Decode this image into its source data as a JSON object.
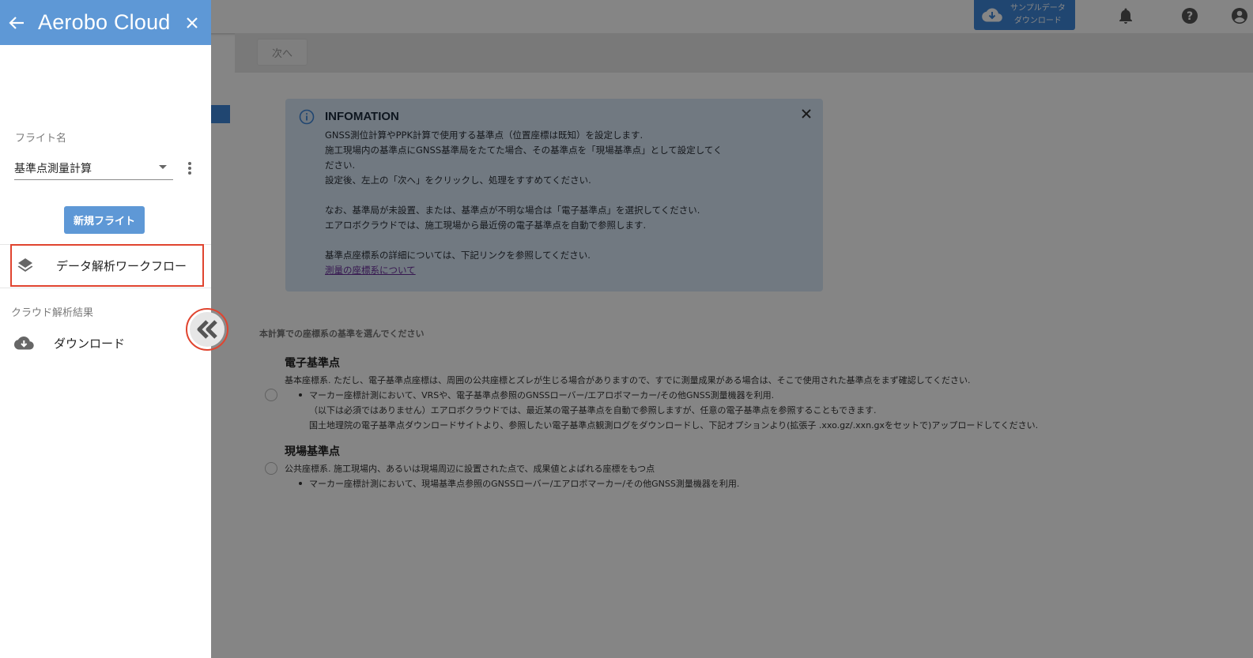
{
  "topbar": {
    "sample_download_line1": "サンプルデータ",
    "sample_download_line2": "ダウンロード",
    "icons": [
      "cloud-download-icon",
      "bell-icon",
      "help-icon",
      "account-icon"
    ]
  },
  "toolbar": {
    "next_label": "次へ"
  },
  "info": {
    "title": "INFOMATION",
    "lines_a": [
      "GNSS測位計算やPPK計算で使用する基準点（位置座標は既知）を設定します.",
      "施工現場内の基準点にGNSS基準局をたてた場合、その基準点を「現場基準点」として設定してく",
      "ださい.",
      "設定後、左上の「次へ」をクリックし、処理をすすめてください."
    ],
    "lines_b": [
      "なお、基準局が未設置、または、基準点が不明な場合は「電子基準点」を選択してください.",
      "エアロボクラウドでは、施工現場から最近傍の電子基準点を自動で参照します."
    ],
    "lines_c": [
      "基準点座標系の詳細については、下記リンクを参照してください."
    ],
    "link": "測量の座標系について"
  },
  "coord_select": {
    "label": "本計算での座標系の基準を選んでください",
    "option1": {
      "title": "電子基準点",
      "desc": "基本座標系. ただし、電子基準点座標は、周囲の公共座標とズレが生じる場合がありますので、すでに測量成果がある場合は、そこで使用された基準点をまず確認してください.",
      "bullet": "マーカー座標計測において、VRSや、電子基準点参照のGNSSローバー/エアロボマーカー/その他GNSS測量機器を利用.",
      "sub1": "（以下は必須ではありません）エアロボクラウドでは、最近某の電子基準点を自動で参照しますが、任意の電子基準点を参照することもできます.",
      "sub2": "国土地理院の電子基準点ダウンロードサイトより、参照したい電子基準点観測ログをダウンロードし、下記オプションより(拡張子 .xxo.gz/.xxn.gxをセットで)アップロードしてください."
    },
    "option2": {
      "title": "現場基準点",
      "desc": "公共座標系. 施工現場内、あるいは現場周辺に設置された点で、成果値とよばれる座標をもつ点",
      "bullet": "マーカー座標計測において、現場基準点参照のGNSSローバー/エアロボマーカー/その他GNSS測量機器を利用."
    }
  },
  "drawer": {
    "title": "Aerobo Cloud",
    "flight_label": "フライト名",
    "flight_value": "基準点測量計算",
    "new_flight": "新規フライト",
    "workflow_item": "データ解析ワークフロー",
    "section_label": "クラウド解析結果",
    "download_item": "ダウンロード"
  },
  "colors": {
    "accent": "#5e98d6",
    "highlight": "#e0442f",
    "info_bg": "#d9e8f8"
  }
}
